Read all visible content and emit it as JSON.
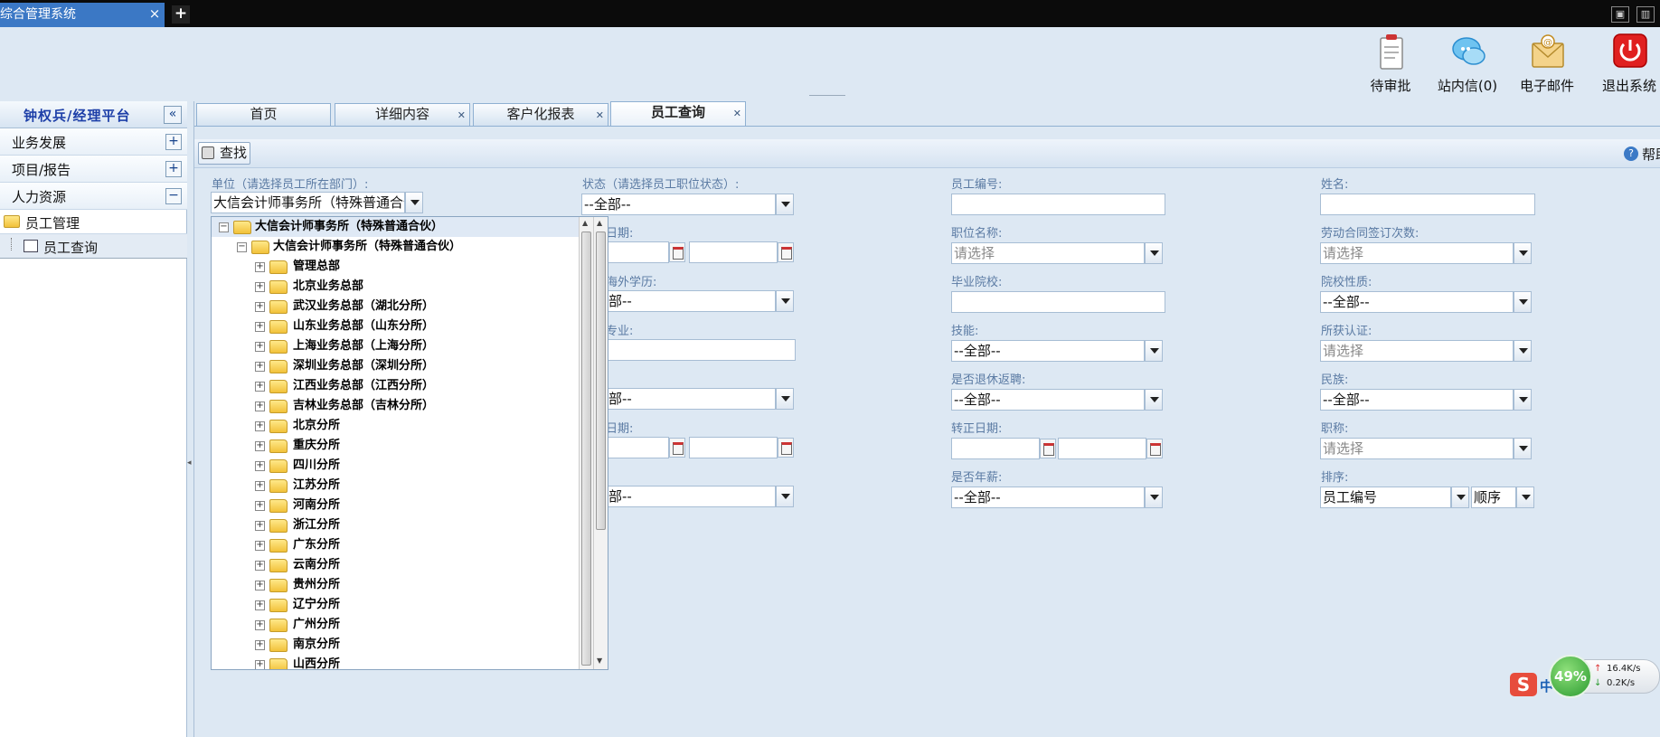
{
  "browser": {
    "tab_title": "综合管理系统",
    "close_glyph": "×",
    "new_tab_glyph": "+"
  },
  "header": {
    "buttons": [
      {
        "label": "待审批",
        "icon": "clipboard-icon"
      },
      {
        "label": "站内信(0)",
        "icon": "chat-bubble-icon"
      },
      {
        "label": "电子邮件",
        "icon": "mail-icon"
      },
      {
        "label": "退出系统",
        "icon": "power-icon"
      }
    ]
  },
  "sidebar": {
    "title": "钟权兵/经理平台",
    "collapse_glyph": "«",
    "items": [
      {
        "label": "业务发展",
        "toggle": "+"
      },
      {
        "label": "项目/报告",
        "toggle": "+"
      },
      {
        "label": "人力资源",
        "toggle": "−"
      }
    ],
    "subitems": [
      {
        "label": "员工管理",
        "icon": "folder-icon"
      },
      {
        "label": "员工查询",
        "icon": "list-icon"
      }
    ]
  },
  "tabs": [
    {
      "label": "首页",
      "closable": false
    },
    {
      "label": "详细内容",
      "closable": true
    },
    {
      "label": "客户化报表",
      "closable": true
    },
    {
      "label": "员工查询",
      "closable": true,
      "active": true
    }
  ],
  "toolbar": {
    "find_label": "查找",
    "help_label": "帮助"
  },
  "form": {
    "col1": {
      "unit_label": "单位（请选择员工所在部门）:",
      "unit_value": "大信会计师事务所（特殊普通合伙）",
      "date_label_partial": "日期:",
      "overseas_label_partial": "海外学历:",
      "overseas_value_partial": "部--",
      "major_label_partial": "专业:",
      "row5_label_partial": ":",
      "row5_value_partial": "部--",
      "date2_label_partial": "日期:",
      "row7_value_partial": "部--"
    },
    "col2": {
      "status_label": "状态（请选择员工职位状态）:",
      "status_value": "--全部--"
    },
    "col3": {
      "emp_no_label": "员工编号:",
      "position_label": "职位名称:",
      "position_placeholder": "请选择",
      "school_label": "毕业院校:",
      "skill_label": "技能:",
      "skill_value": "--全部--",
      "retired_label": "是否退休返聘:",
      "retired_value": "--全部--",
      "regular_date_label": "转正日期:",
      "annuity_label": "是否年薪:",
      "annuity_value": "--全部--"
    },
    "col4": {
      "name_label": "姓名:",
      "contract_label": "劳动合同签订次数:",
      "contract_placeholder": "请选择",
      "school_type_label": "院校性质:",
      "school_type_value": "--全部--",
      "cert_label": "所获认证:",
      "cert_placeholder": "请选择",
      "ethnic_label": "民族:",
      "ethnic_value": "--全部--",
      "title_label": "职称:",
      "title_placeholder": "请选择",
      "sort_label": "排序:",
      "sort_field": "员工编号",
      "sort_order": "顺序"
    }
  },
  "tree": {
    "root": "大信会计师事务所（特殊普通合伙）",
    "child": "大信会计师事务所（特殊普通合伙）",
    "nodes": [
      "管理总部",
      "北京业务总部",
      "武汉业务总部（湖北分所）",
      "山东业务总部（山东分所）",
      "上海业务总部（上海分所）",
      "深圳业务总部（深圳分所）",
      "江西业务总部（江西分所）",
      "吉林业务总部（吉林分所）",
      "北京分所",
      "重庆分所",
      "四川分所",
      "江苏分所",
      "河南分所",
      "浙江分所",
      "广东分所",
      "云南分所",
      "贵州分所",
      "辽宁分所",
      "广州分所",
      "南京分所",
      "山西分所"
    ],
    "expand_glyph": "+",
    "collapse_glyph": "−"
  },
  "tray": {
    "percent": "49%",
    "up_speed": "16.4K/s",
    "down_speed": "0.2K/s",
    "sogou_glyph": "S",
    "sogou_text": "中"
  }
}
